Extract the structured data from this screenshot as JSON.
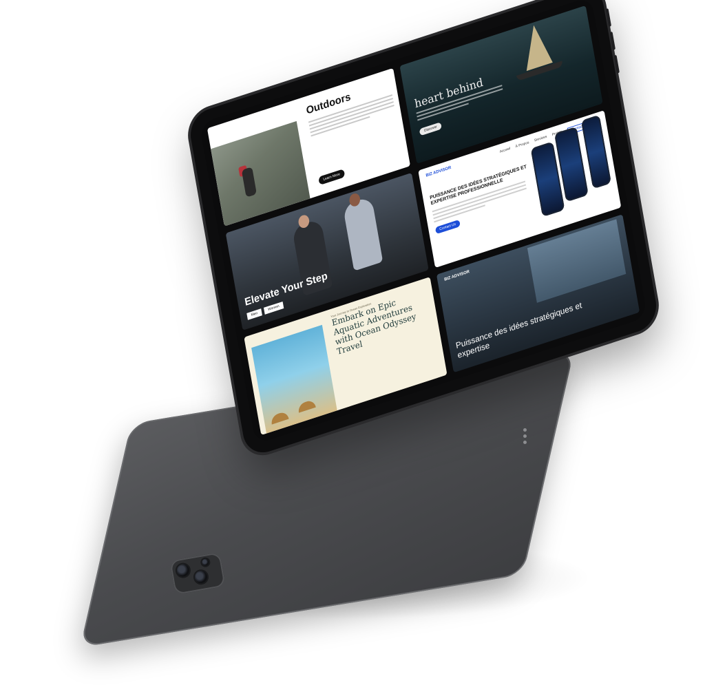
{
  "panels": {
    "outdoors": {
      "title": "Outdoors",
      "button": "Learn More"
    },
    "sea": {
      "title": "heart behind",
      "button": "Discover"
    },
    "elevate": {
      "title": "Elevate Your Step",
      "button1": "Men",
      "button2": "Women"
    },
    "biz": {
      "logo": "BIZ ADVISOR",
      "nav": [
        "Accueil",
        "À Propos",
        "Services",
        "Projets"
      ],
      "cta": "Contactez-Nous",
      "title": "PUISSANCE DES IDÉES STRATÉGIQUES ET EXPERTISE PROFESSIONNELLE",
      "button": "Contact Us"
    },
    "ocean": {
      "kicker": "Your Journey to Ocean Exploration",
      "title": "Embark on Epic Aquatic Adventures with Ocean Odyssey Travel"
    },
    "office": {
      "logo": "BIZ ADVISOR",
      "title": "Puissance des idées stratégiques et expertise"
    }
  },
  "colors": {
    "accent_blue": "#1d4ed8",
    "device_frame": "#0d0d0e",
    "device_back": "#4a4b4e",
    "ocean_bg": "#f6f1df"
  }
}
